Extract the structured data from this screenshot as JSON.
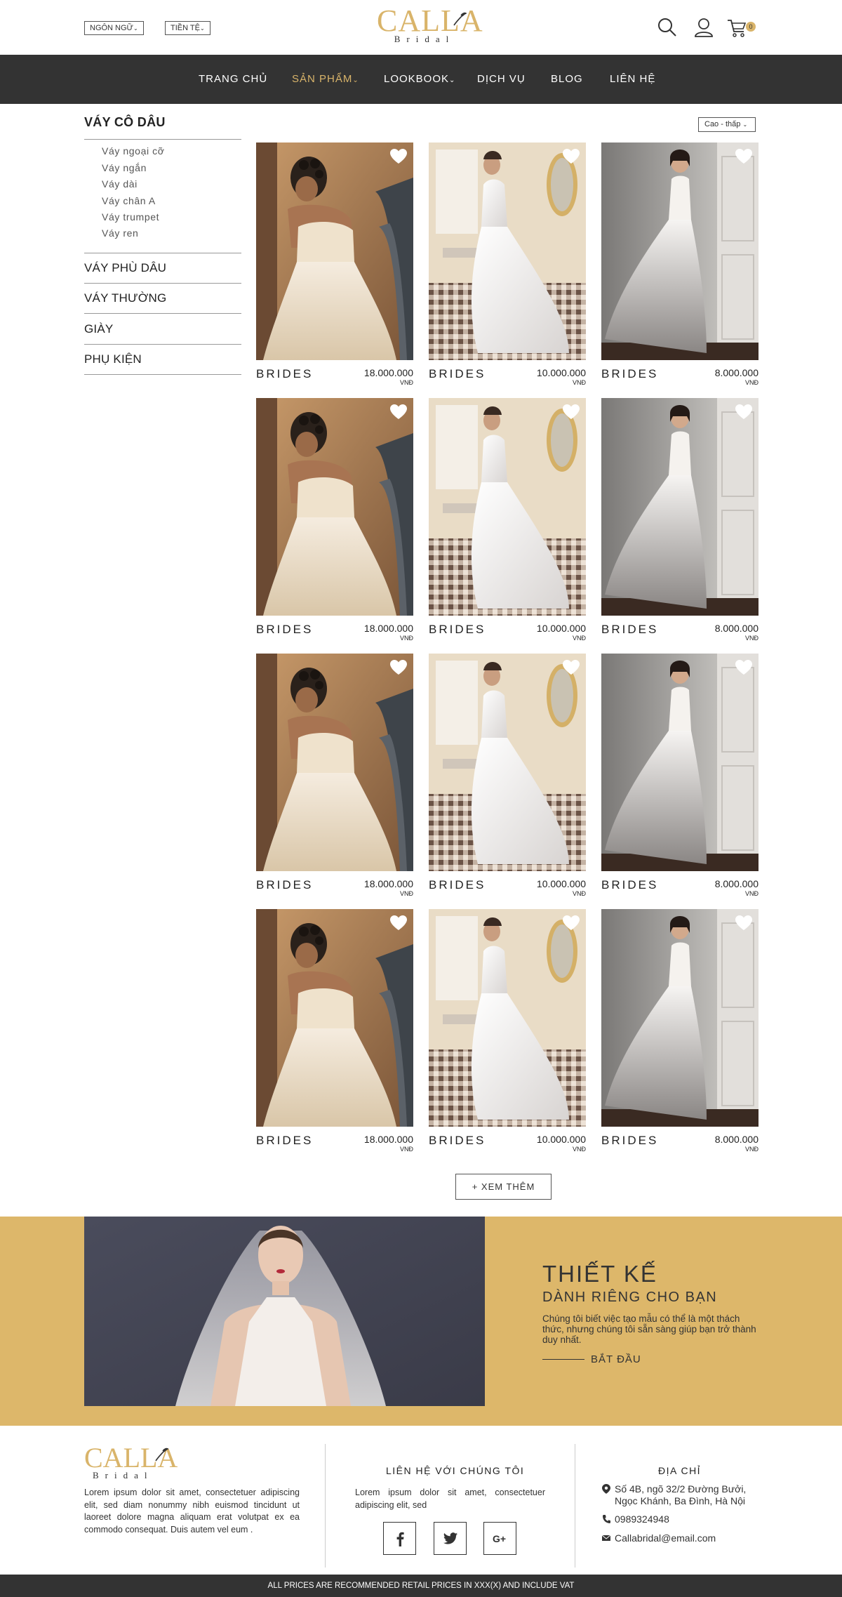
{
  "header": {
    "language_label": "NGÔN NGỮ",
    "currency_label": "TIỀN TỆ",
    "logo_main": "CALLA",
    "logo_sub": "Bridal",
    "cart_count": "0"
  },
  "nav": {
    "items": [
      {
        "label": "TRANG CHỦ"
      },
      {
        "label": "SẢN PHẨM"
      },
      {
        "label": "LOOKBOOK"
      },
      {
        "label": "DỊCH VỤ"
      },
      {
        "label": "BLOG"
      },
      {
        "label": "LIÊN HỆ"
      }
    ]
  },
  "sidebar": {
    "title": "VÁY CÔ DÂU",
    "sub_items": [
      {
        "label": "Váy ngoại cỡ"
      },
      {
        "label": "Váy ngắn"
      },
      {
        "label": "Váy dài"
      },
      {
        "label": "Váy chân A"
      },
      {
        "label": "Váy trumpet"
      },
      {
        "label": "Váy ren"
      }
    ],
    "categories": [
      {
        "label": "VÁY PHÙ DÂU"
      },
      {
        "label": "VÁY THƯỜNG"
      },
      {
        "label": "GIÀY"
      },
      {
        "label": "PHỤ KIỆN"
      }
    ]
  },
  "sort": {
    "value": "Cao - thấp"
  },
  "products": [
    {
      "name": "BRIDES",
      "price": "18.000.000",
      "unit": "VNĐ"
    },
    {
      "name": "BRIDES",
      "price": "10.000.000",
      "unit": "VNĐ"
    },
    {
      "name": "BRIDES",
      "price": "8.000.000",
      "unit": "VNĐ"
    },
    {
      "name": "BRIDES",
      "price": "18.000.000",
      "unit": "VNĐ"
    },
    {
      "name": "BRIDES",
      "price": "10.000.000",
      "unit": "VNĐ"
    },
    {
      "name": "BRIDES",
      "price": "8.000.000",
      "unit": "VNĐ"
    },
    {
      "name": "BRIDES",
      "price": "18.000.000",
      "unit": "VNĐ"
    },
    {
      "name": "BRIDES",
      "price": "10.000.000",
      "unit": "VNĐ"
    },
    {
      "name": "BRIDES",
      "price": "8.000.000",
      "unit": "VNĐ"
    },
    {
      "name": "BRIDES",
      "price": "18.000.000",
      "unit": "VNĐ"
    },
    {
      "name": "BRIDES",
      "price": "10.000.000",
      "unit": "VNĐ"
    },
    {
      "name": "BRIDES",
      "price": "8.000.000",
      "unit": "VNĐ"
    }
  ],
  "load_more_label": "+ XEM THÊM",
  "banner": {
    "title": "THIẾT KẾ",
    "subtitle": "DÀNH RIÊNG CHO BẠN",
    "text": "Chúng tôi biết việc tạo mẫu có thể là một thách thức, nhưng chúng tôi sẵn sàng giúp bạn trở thành duy nhất.",
    "cta": "BẮT ĐẦU"
  },
  "footer": {
    "logo_main": "CALLA",
    "logo_sub": "Bridal",
    "about_text": "Lorem ipsum dolor sit amet, consectetuer adipiscing elit, sed diam nonummy nibh euismod tincidunt ut laoreet dolore magna aliquam erat volutpat ex ea commodo consequat. Duis autem vel eum .",
    "contact_title": "LIÊN HỆ VỚI CHÚNG TÔI",
    "contact_text": "Lorem ipsum dolor sit amet, consectetuer adipiscing elit, sed",
    "address_title": "ĐỊA CHỈ",
    "address_line1": "Số 4B, ngõ 32/2 Đường Bưởi,",
    "address_line2": "Ngọc Khánh, Ba Đình, Hà Nội",
    "phone": "0989324948",
    "email": "Callabridal@email.com"
  },
  "bottom_bar": "ALL PRICES ARE RECOMMENDED RETAIL PRICES IN XXX(X) AND INCLUDE VAT",
  "colors": {
    "accent": "#d9b46a",
    "nav_bg": "#333333",
    "banner_bg": "#ddb76a"
  }
}
